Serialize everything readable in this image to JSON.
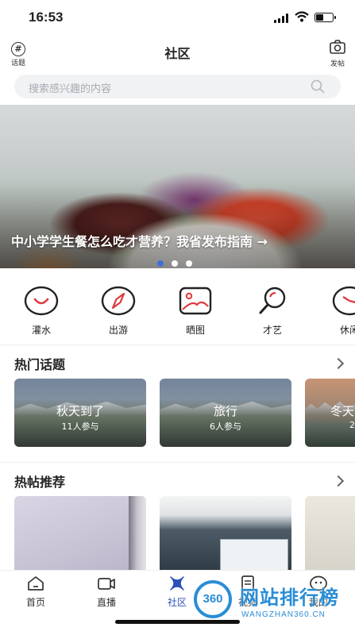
{
  "status_bar": {
    "time": "16:53",
    "battery_level": 0.45
  },
  "header": {
    "title": "社区",
    "topic_btn_label": "话题",
    "post_btn_label": "发帖"
  },
  "search": {
    "placeholder": "搜索感兴趣的内容"
  },
  "banner": {
    "caption": "中小学学生餐怎么吃才营养？我省发布指南 →",
    "page_count": 3,
    "active_page": 1
  },
  "categories": [
    {
      "label": "灌水",
      "icon": "smile-circle-icon"
    },
    {
      "label": "出游",
      "icon": "compass-icon"
    },
    {
      "label": "晒图",
      "icon": "image-icon"
    },
    {
      "label": "才艺",
      "icon": "magnifier-icon"
    },
    {
      "label": "休闲",
      "icon": "clock-icon"
    }
  ],
  "hot_topics": {
    "title": "热门话题",
    "items": [
      {
        "name": "秋天到了",
        "count": "11人参与"
      },
      {
        "name": "旅行",
        "count": "6人参与"
      },
      {
        "name": "冬天",
        "count": "2"
      }
    ]
  },
  "hot_posts": {
    "title": "热帖推荐"
  },
  "tabbar": {
    "items": [
      {
        "label": "首页",
        "icon": "home-icon"
      },
      {
        "label": "直播",
        "icon": "video-icon"
      },
      {
        "label": "社区",
        "icon": "community-icon",
        "active": true
      },
      {
        "label": "视频",
        "icon": "document-icon"
      },
      {
        "label": "我的",
        "icon": "user-face-icon"
      }
    ]
  },
  "watermark": {
    "logo_text": "360",
    "title": "网站排行榜",
    "subtitle": "WANGZHAN360.CN"
  },
  "colors": {
    "accent": "#3f6fd8",
    "tab_active": "#2c4fb8",
    "search_bg": "#f1f2f4",
    "icon_red": "#e0393e"
  }
}
